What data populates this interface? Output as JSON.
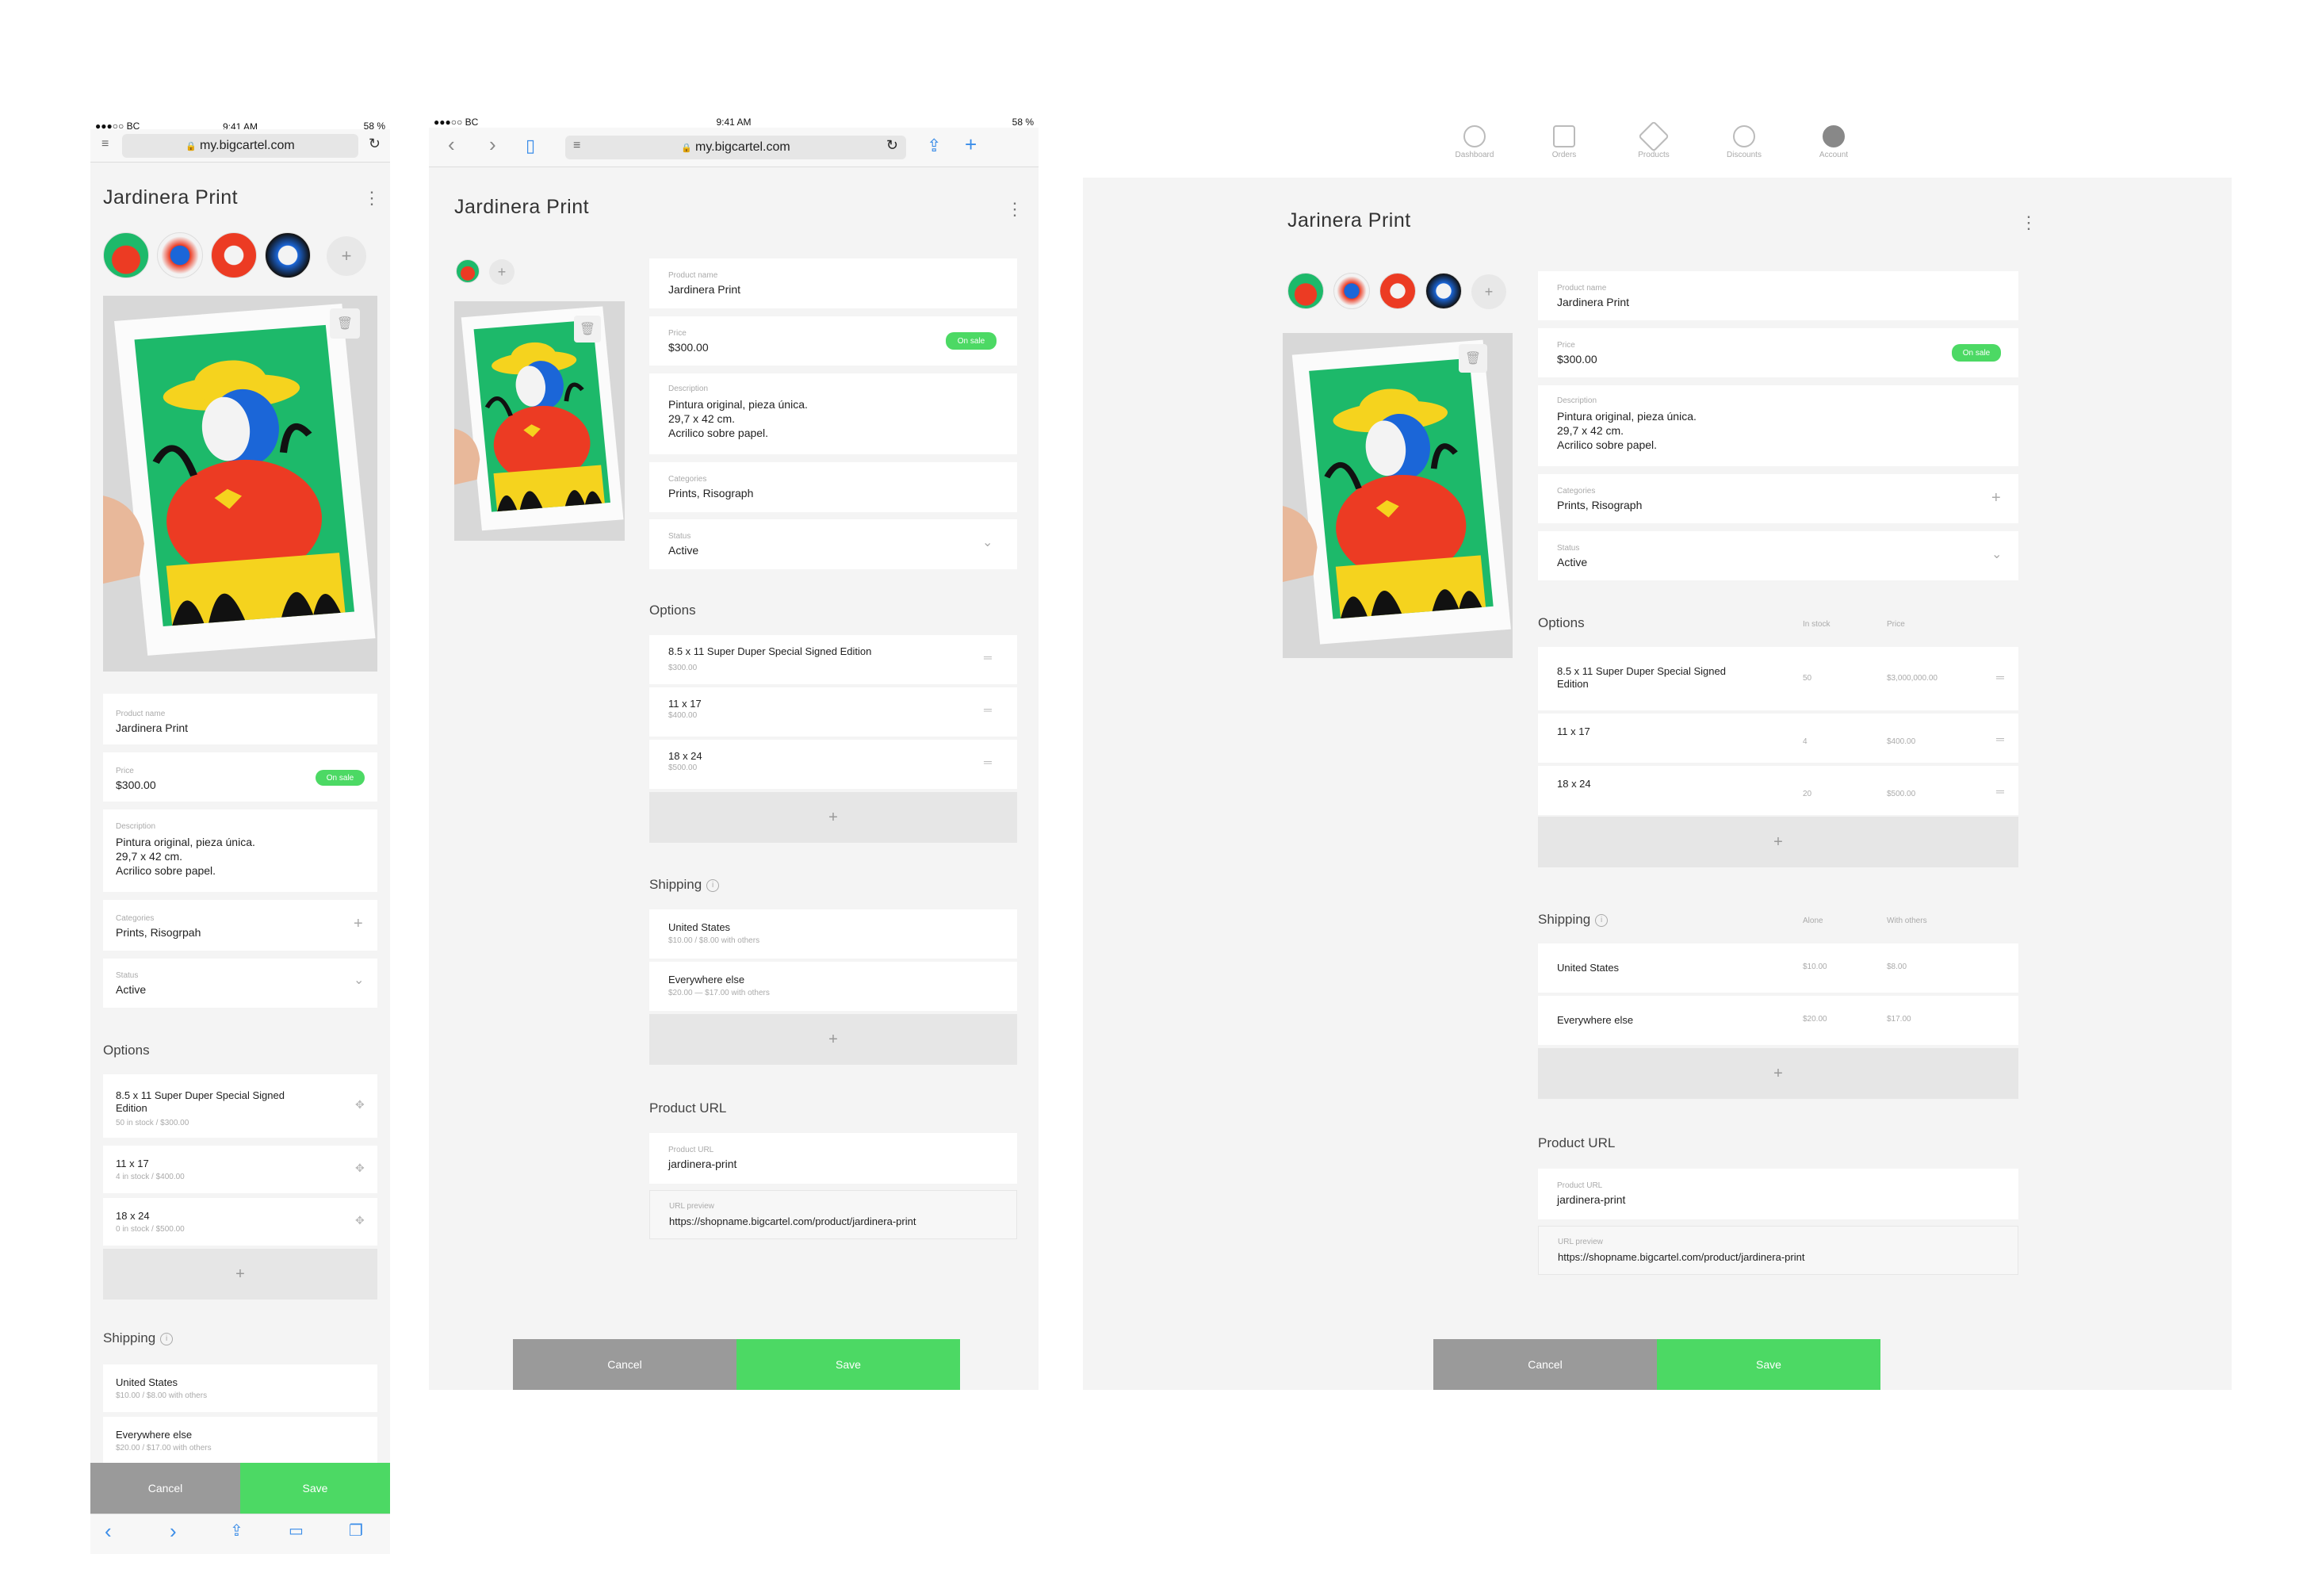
{
  "status_bar": {
    "carrier": "●●●○○ BC",
    "time": "9:41 AM",
    "battery": "58 %"
  },
  "browser": {
    "url": "my.bigcartel.com"
  },
  "nav": [
    {
      "label": "Dashboard",
      "icon": "dashboard-icon"
    },
    {
      "label": "Orders",
      "icon": "orders-icon"
    },
    {
      "label": "Products",
      "icon": "products-icon"
    },
    {
      "label": "Discounts",
      "icon": "discounts-icon"
    },
    {
      "label": "Account",
      "icon": "account-icon"
    }
  ],
  "phone": {
    "title": "Jardinera Print",
    "product_name": {
      "label": "Product name",
      "value": "Jardinera Print"
    },
    "price": {
      "label": "Price",
      "value": "$300.00",
      "badge": "On sale"
    },
    "description": {
      "label": "Description",
      "lines": [
        "Pintura original, pieza única.",
        "29,7 x 42 cm.",
        "Acrilico sobre papel."
      ]
    },
    "categories": {
      "label": "Categories",
      "value": "Prints, Risogrpah"
    },
    "status": {
      "label": "Status",
      "value": "Active"
    },
    "options_title": "Options",
    "options": [
      {
        "name": "8.5 x 11 Super Duper Special Signed",
        "name2": "Edition",
        "meta": "50 in stock / $300.00"
      },
      {
        "name": "11 x 17",
        "meta": "4 in stock  /  $400.00"
      },
      {
        "name": "18 x 24",
        "meta": "0 in stock  /  $500.00"
      }
    ],
    "shipping_title": "Shipping",
    "shipping": [
      {
        "name": "United States",
        "meta": "$10.00  /  $8.00 with others"
      },
      {
        "name": "Everywhere else",
        "meta": "$20.00  /  $17.00 with others"
      }
    ],
    "cancel": "Cancel",
    "save": "Save"
  },
  "tablet": {
    "title": "Jardinera Print",
    "product_name": {
      "label": "Product name",
      "value": "Jardinera Print"
    },
    "price": {
      "label": "Price",
      "value": "$300.00",
      "badge": "On sale"
    },
    "description": {
      "label": "Description",
      "lines": [
        "Pintura original, pieza única.",
        "29,7 x 42 cm.",
        "Acrilico sobre papel."
      ]
    },
    "categories": {
      "label": "Categories",
      "value": "Prints, Risograph"
    },
    "status": {
      "label": "Status",
      "value": "Active"
    },
    "options_title": "Options",
    "options": [
      {
        "name": "8.5 x 11 Super Duper Special Signed Edition",
        "meta": "$300.00"
      },
      {
        "name": "11 x 17",
        "meta": "$400.00"
      },
      {
        "name": "18 x 24",
        "meta": "$500.00"
      }
    ],
    "shipping_title": "Shipping",
    "shipping": [
      {
        "name": "United States",
        "meta": "$10.00  /  $8.00 with others"
      },
      {
        "name": "Everywhere else",
        "meta": "$20.00  —  $17.00 with others"
      }
    ],
    "url_title": "Product URL",
    "product_url": {
      "label": "Product URL",
      "value": "jardinera-print"
    },
    "url_preview": {
      "label": "URL preview",
      "value": "https://shopname.bigcartel.com/product/jardinera-print"
    },
    "cancel": "Cancel",
    "save": "Save"
  },
  "desktop": {
    "title": "Jarinera Print",
    "product_name": {
      "label": "Product name",
      "value": "Jardinera Print"
    },
    "price": {
      "label": "Price",
      "value": "$300.00",
      "badge": "On sale"
    },
    "description": {
      "label": "Description",
      "lines": [
        "Pintura original, pieza única.",
        "29,7 x 42 cm.",
        "Acrilico sobre papel."
      ]
    },
    "categories": {
      "label": "Categories",
      "value": "Prints, Risograph"
    },
    "status": {
      "label": "Status",
      "value": "Active"
    },
    "options_title": "Options",
    "options_cols": {
      "stock": "In stock",
      "price": "Price"
    },
    "options": [
      {
        "name": "8.5 x 11 Super Duper Special Signed",
        "name2": "Edition",
        "stock": "50",
        "price": "$3,000,000.00"
      },
      {
        "name": "11 x 17",
        "stock": "4",
        "price": "$400.00"
      },
      {
        "name": "18 x 24",
        "stock": "20",
        "price": "$500.00"
      }
    ],
    "shipping_title": "Shipping",
    "shipping_cols": {
      "alone": "Alone",
      "others": "With others"
    },
    "shipping": [
      {
        "name": "United States",
        "alone": "$10.00",
        "others": "$8.00"
      },
      {
        "name": "Everywhere else",
        "alone": "$20.00",
        "others": "$17.00"
      }
    ],
    "url_title": "Product URL",
    "product_url": {
      "label": "Product URL",
      "value": "jardinera-print"
    },
    "url_preview": {
      "label": "URL preview",
      "value": "https://shopname.bigcartel.com/product/jardinera-print"
    },
    "cancel": "Cancel",
    "save": "Save"
  }
}
